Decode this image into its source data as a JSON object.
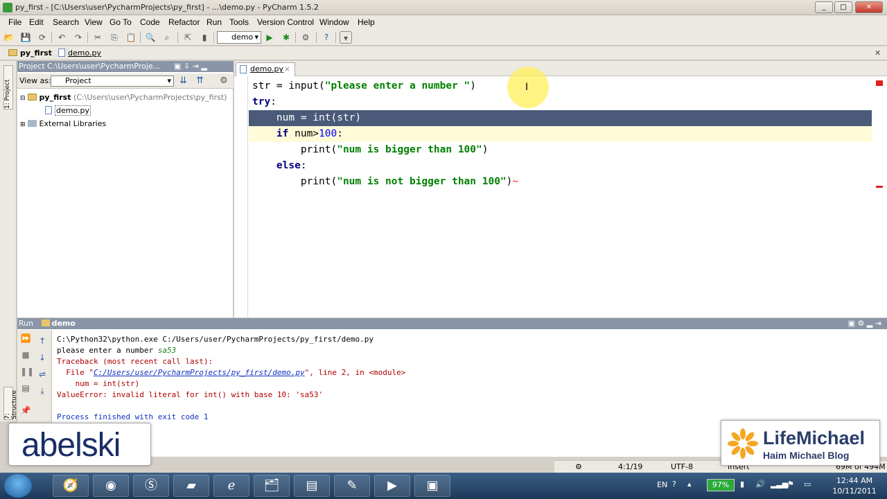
{
  "window": {
    "title": "py_first - [C:\\Users\\user\\PycharmProjects\\py_first] - ...\\demo.py - PyCharm 1.5.2"
  },
  "menu": [
    "File",
    "Edit",
    "Search",
    "View",
    "Go To",
    "Code",
    "Refactor",
    "Run",
    "Tools",
    "Version Control",
    "Window",
    "Help"
  ],
  "toolbar": {
    "run_config": "demo"
  },
  "nav": {
    "project": "py_first",
    "file": "demo.py"
  },
  "left_strip": {
    "project_tab": "1: Project",
    "structure_tab": "7: Structure"
  },
  "project_panel": {
    "header": "Project  C:\\Users\\user\\PycharmProje...",
    "view_as_label": "View as:",
    "view_as_value": "Project",
    "tree": [
      {
        "name": "py_first",
        "path": "(C:\\Users\\user\\PycharmProjects\\py_first)"
      },
      {
        "name": "demo.py"
      },
      {
        "name": "External Libraries"
      }
    ]
  },
  "editor": {
    "tab": "demo.py",
    "lines": [
      "str = input(\"please enter a number \")",
      "try:",
      "    num = int(str)",
      "    if num>100:",
      "        print(\"num is bigger than 100\")",
      "    else:",
      "        print(\"num is not bigger than 100\")"
    ]
  },
  "run_panel": {
    "header_label": "Run",
    "header_config": "demo",
    "console": {
      "l1": "C:\\Python32\\python.exe C:/Users/user/PycharmProjects/py_first/demo.py",
      "l2_prefix": "please enter a number ",
      "l2_input": "sa53",
      "l3": "Traceback (most recent call last):",
      "l4_prefix": "  File \"",
      "l4_link": "C:/Users/user/PycharmProjects/py_first/demo.py",
      "l4_suffix": "\", line 2, in <module>",
      "l5": "    num = int(str)",
      "l6": "ValueError: invalid literal for int() with base 10: 'sa53'",
      "l8": "Process finished with exit code 1"
    }
  },
  "status": {
    "position": "4:1/19",
    "encoding": "UTF-8",
    "mode": "Insert",
    "memory": "69M of 494M"
  },
  "overlays": {
    "abelski": "abelski",
    "lm_title": "LifeMichael",
    "lm_sub": "Haim Michael Blog"
  },
  "tray": {
    "lang": "EN",
    "battery": "97%",
    "time": "12:44 AM",
    "date": "10/11/2011"
  },
  "colors": {
    "selection": "#4a5a78",
    "caret_line": "#fffbd8",
    "string": "#008000",
    "keyword": "#000080",
    "error": "#b00000"
  }
}
